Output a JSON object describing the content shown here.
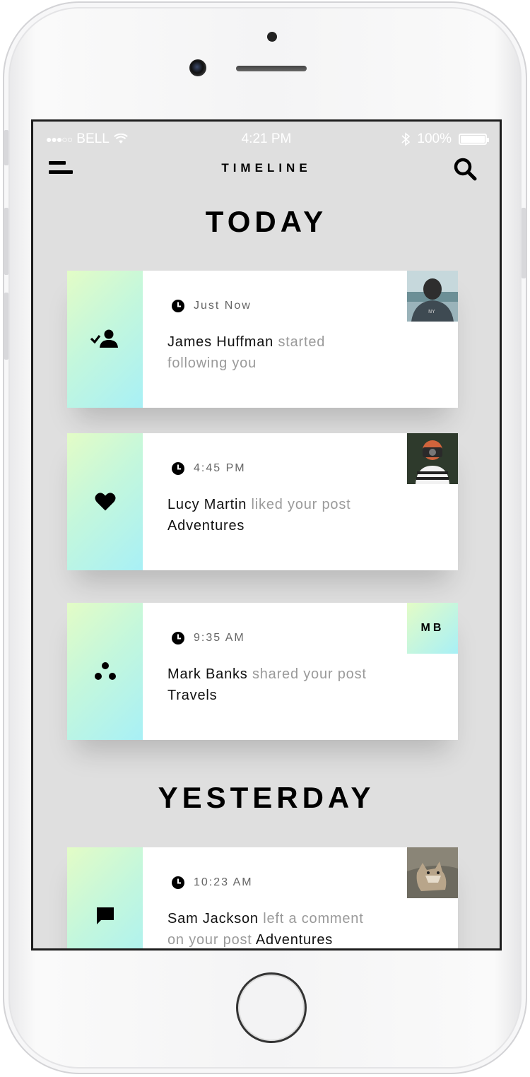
{
  "status_bar": {
    "signal": "●●●○○",
    "carrier": "BELL",
    "time": "4:21 PM",
    "battery_text": "100%",
    "battery_level": 1.0
  },
  "nav": {
    "title": "TIMELINE"
  },
  "sections": {
    "today": "TODAY",
    "yesterday": "YESTERDAY"
  },
  "cards": [
    {
      "time": "Just Now",
      "actor": "James Huffman",
      "action": " started following you",
      "object": "",
      "type_icon": "follow-icon"
    },
    {
      "time": "4:45 PM",
      "actor": "Lucy Martin",
      "action": " liked your post ",
      "object": "Adventures",
      "type_icon": "heart-icon"
    },
    {
      "time": "9:35 AM",
      "actor": "Mark Banks",
      "action": " shared your post ",
      "object": "Travels",
      "initials": "MB",
      "type_icon": "share-icon"
    },
    {
      "time": "10:23 AM",
      "actor": "Sam Jackson",
      "action": " left a comment on your post ",
      "object": "Adventures",
      "type_icon": "comment-icon"
    }
  ],
  "colors": {
    "accent_start": "#e3fcc6",
    "accent_end": "#a8f0f6",
    "screen_bg": "#dfdfdf"
  }
}
